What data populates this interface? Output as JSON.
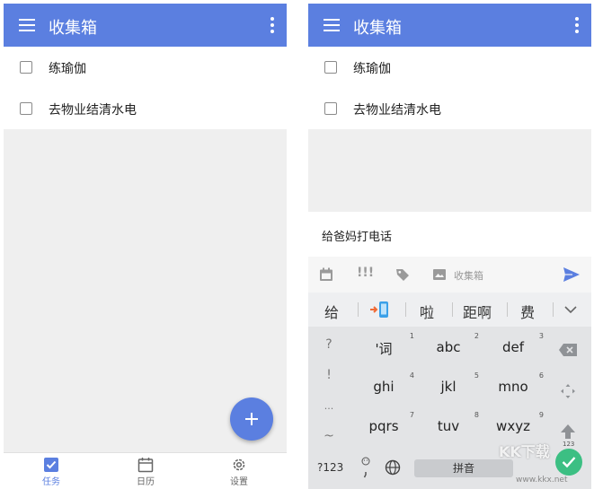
{
  "left_screen": {
    "appbar": {
      "title": "收集箱"
    },
    "tasks": [
      {
        "text": "练瑜伽",
        "checked": false
      },
      {
        "text": "去物业结清水电",
        "checked": false
      }
    ],
    "bottom_nav": [
      {
        "label": "任务",
        "icon": "checkbox-icon",
        "active": true
      },
      {
        "label": "日历",
        "icon": "calendar-icon",
        "active": false
      },
      {
        "label": "设置",
        "icon": "gear-icon",
        "active": false
      }
    ]
  },
  "right_screen": {
    "appbar": {
      "title": "收集箱"
    },
    "tasks": [
      {
        "text": "练瑜伽",
        "checked": false
      },
      {
        "text": "去物业结清水电",
        "checked": false
      }
    ],
    "input": {
      "value": "给爸妈打电话"
    },
    "toolbar": {
      "priority_label": "!!!",
      "list_label": "收集箱"
    },
    "keyboard": {
      "candidates": [
        "给",
        "啦",
        "距啊",
        "费"
      ],
      "side_keys": [
        "?",
        "!",
        "...",
        "~"
      ],
      "keys": [
        {
          "label": "'词",
          "num": "1"
        },
        {
          "label": "abc",
          "num": "2"
        },
        {
          "label": "def",
          "num": "3"
        },
        {
          "label": "ghi",
          "num": "4"
        },
        {
          "label": "jkl",
          "num": "5"
        },
        {
          "label": "mno",
          "num": "6"
        },
        {
          "label": "pqrs",
          "num": "7"
        },
        {
          "label": "tuv",
          "num": "8"
        },
        {
          "label": "wxyz",
          "num": "9"
        }
      ],
      "symbol_key": "?123",
      "space_label": "拼音",
      "shift_sub": "123"
    }
  },
  "watermark": {
    "text": "KK下载",
    "url": "www.kkx.net"
  },
  "colors": {
    "primary": "#5b7fe0",
    "enter": "#3cbf83"
  }
}
